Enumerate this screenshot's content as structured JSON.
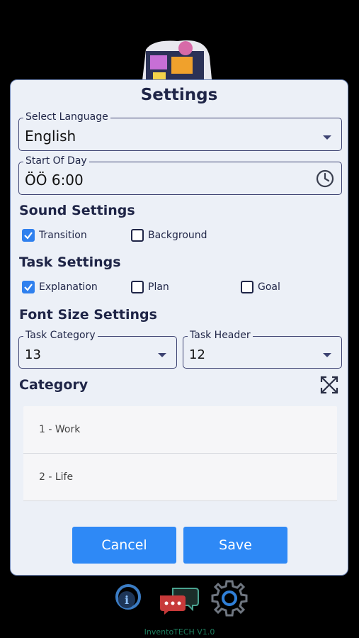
{
  "dialog": {
    "title": "Settings",
    "language": {
      "label": "Select Language",
      "value": "English"
    },
    "start_of_day": {
      "label": "Start Of Day",
      "value": "ÖÖ 6:00"
    },
    "sound": {
      "title": "Sound Settings",
      "options": [
        {
          "label": "Transition",
          "checked": true
        },
        {
          "label": "Background",
          "checked": false
        }
      ]
    },
    "task": {
      "title": "Task Settings",
      "options": [
        {
          "label": "Explanation",
          "checked": true
        },
        {
          "label": "Plan",
          "checked": false
        },
        {
          "label": "Goal",
          "checked": false
        }
      ]
    },
    "font": {
      "title": "Font Size Settings",
      "task_category": {
        "label": "Task Category",
        "value": "13"
      },
      "task_header": {
        "label": "Task Header",
        "value": "12"
      }
    },
    "category": {
      "title": "Category",
      "items": [
        "1 - Work",
        "2 - Life"
      ]
    },
    "cancel_label": "Cancel",
    "save_label": "Save"
  },
  "dock": {
    "icons": [
      "info-icon",
      "chat-icon",
      "gear-icon"
    ]
  },
  "footer": "InventoTECH V1.0",
  "colors": {
    "accent": "#2e89f6",
    "dialog_bg": "#ecf0f7",
    "text_dark": "#1f2547"
  }
}
